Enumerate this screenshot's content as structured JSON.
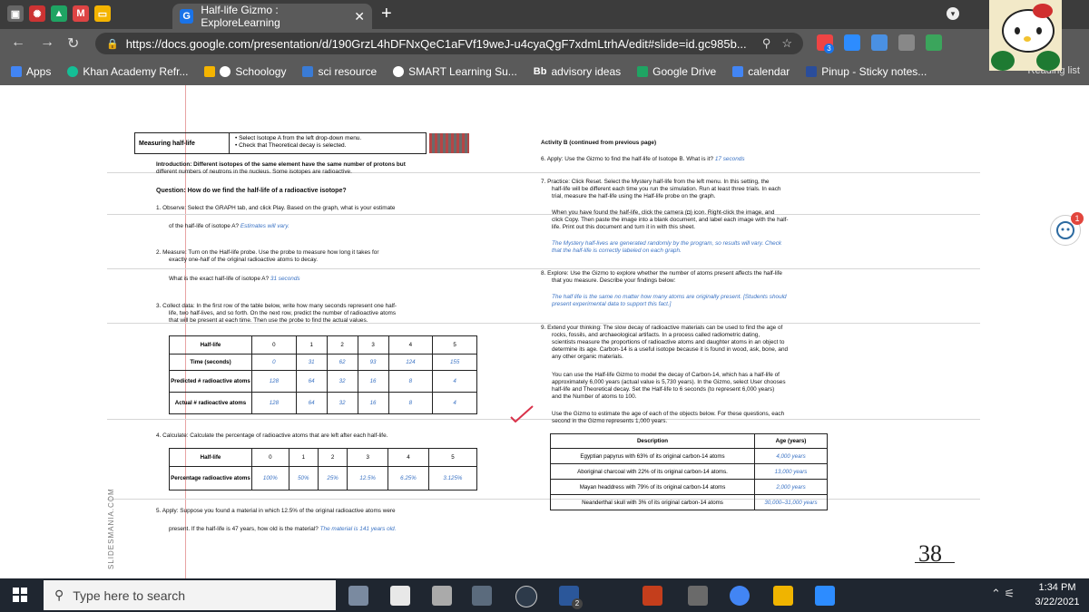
{
  "browser": {
    "tab_title": "Half-life Gizmo : ExploreLearning",
    "url": "https://docs.google.com/presentation/d/190GrzL4hDFNxQeC1aFVf19weJ-u4cyaQgF7xdmLtrhA/edit#slide=id.gc985b...",
    "ext_badge": "3",
    "bookmarks": [
      "Apps",
      "Khan Academy Refr...",
      "Schoology",
      "sci resource",
      "SMART Learning Su...",
      "advisory ideas",
      "Google Drive",
      "calendar",
      "Pinup - Sticky notes..."
    ],
    "reading_list": "Reading list"
  },
  "doc": {
    "top_label": "Measuring half-life",
    "top_bullets": [
      "Select Isotope A from the left drop-down menu.",
      "Check that Theoretical decay is selected."
    ],
    "intro_1": "Introduction: Different isotopes of the same element have the same number of protons but",
    "intro_2": "different numbers of neutrons in the nucleus. Some isotopes are radioactive.",
    "question": "Question: How do we find the half-life of a radioactive isotope?",
    "q1a": "1.  Observe: Select the GRAPH tab, and click Play. Based on the graph, what is your estimate",
    "q1b": "of the half-life of isotope A?",
    "a1": "Estimates will vary.",
    "q2a": "2.  Measure: Turn on the Half-life probe. Use the probe to measure how long it takes for",
    "q2b": "exactly one-half of the original radioactive atoms to decay.",
    "q2c": "What is the exact half-life of isotope A?",
    "a2": "31 seconds",
    "q3a": "3.  Collect data: In the first row of the table below, write how many seconds represent one half-",
    "q3b": "life, two half-lives, and so forth. On the next row, predict the number of radioactive atoms",
    "q3c": "that will be present at each time. Then use the probe to find the actual values.",
    "table1": {
      "labels": [
        "Half-life",
        "Time (seconds)",
        "Predicted # radioactive atoms",
        "Actual # radioactive atoms"
      ],
      "half_life": [
        "0",
        "1",
        "2",
        "3",
        "4",
        "5"
      ],
      "time": [
        "0",
        "31",
        "62",
        "93",
        "124",
        "155"
      ],
      "predicted": [
        "128",
        "64",
        "32",
        "16",
        "8",
        "4"
      ],
      "actual": [
        "128",
        "64",
        "32",
        "16",
        "8",
        "4"
      ]
    },
    "q4": "4.  Calculate: Calculate the percentage of radioactive atoms that are left after each half-life.",
    "table2": {
      "labels": [
        "Half-life",
        "Percentage radioactive atoms"
      ],
      "half_life": [
        "0",
        "1",
        "2",
        "3",
        "4",
        "5"
      ],
      "percent": [
        "100%",
        "50%",
        "25%",
        "12.5%",
        "6.25%",
        "3.125%"
      ]
    },
    "q5a": "5.  Apply: Suppose you found a material in which 12.5% of the original radioactive atoms were",
    "q5b": "present. If the half-life is 47 years, how old is the material?",
    "a5": "The material is 141 years old.",
    "actb": "Activity B (continued from previous page)",
    "q6": "6.  Apply: Use the Gizmo to find the half-life of Isotope B. What is it?",
    "a6": "17 seconds",
    "q7a": "7.  Practice: Click Reset. Select the Mystery half-life from the left menu. In this setting, the",
    "q7b": "half-life will be different each time you run the simulation. Run at least three trials. In each",
    "q7c": "trial, measure the half-life using the Half-life probe on the graph.",
    "q7d": "When you have found the half-life, click the camera (◘) icon. Right-click the image, and",
    "q7e": "click Copy. Then paste the image into a blank document, and label each image with the half-",
    "q7f": "life. Print out this document and turn it in with this sheet.",
    "a7a": "The Mystery half-lives are generated randomly by the program, so results will vary. Check",
    "a7b": "that the half-life is correctly labeled on each graph.",
    "q8a": "8.  Explore: Use the Gizmo to explore whether the number of atoms present affects the half-life",
    "q8b": "that you measure. Describe your findings below:",
    "a8a": "The half life is the same no matter how many atoms are originally present. [Students should",
    "a8b": "present experimental data to support this fact.]",
    "q9a": "9.  Extend your thinking: The slow decay of radioactive materials can be used to find the age of",
    "q9b": "rocks, fossils, and archaeological artifacts. In a process called radiometric dating,",
    "q9c": "scientists measure the proportions of radioactive atoms and daughter atoms in an object to",
    "q9d": "determine its age. Carbon-14 is a useful isotope because it is found in wood, ask, bone, and",
    "q9e": "any other organic materials.",
    "q9f": "You can use the Half-life Gizmo to model the decay of Carbon-14, which has a half-life of",
    "q9g": "approximately 6,000 years (actual value is 5,730 years). In the Gizmo, select User chooses",
    "q9h": "half-life and Theoretical decay. Set the Half-life to 6 seconds (to represent 6,000 years)",
    "q9i": "and the Number of atoms to 100.",
    "q9j": "Use the Gizmo to estimate the age of each of the objects below. For these questions, each",
    "q9k": "second in the Gizmo represents 1,000 years.",
    "table3": {
      "headers": [
        "Description",
        "Age (years)"
      ],
      "rows": [
        [
          "Egyptian papyrus with 63% of its original carbon-14 atoms",
          "4,000 years"
        ],
        [
          "Aboriginal charcoal with 22% of its original carbon-14 atoms.",
          "13,000 years"
        ],
        [
          "Mayan headdress with 79% of its original carbon-14 atoms",
          "2,000 years"
        ],
        [
          "Neanderthal skull with 3% of its original carbon-14 atoms",
          "30,000–31,000 years"
        ]
      ]
    },
    "slide_number": "38",
    "watermark": "SLIDESMANIA.COM",
    "side_badge": "1"
  },
  "taskbar": {
    "search_placeholder": "Type here to search",
    "badge": "2",
    "time": "1:34 PM",
    "date": "3/22/2021"
  },
  "colors": {
    "answer": "#3b73c4",
    "chrome_dark": "#3c3c3c",
    "chrome": "#5a5a5a",
    "taskbar": "#1f2630"
  }
}
